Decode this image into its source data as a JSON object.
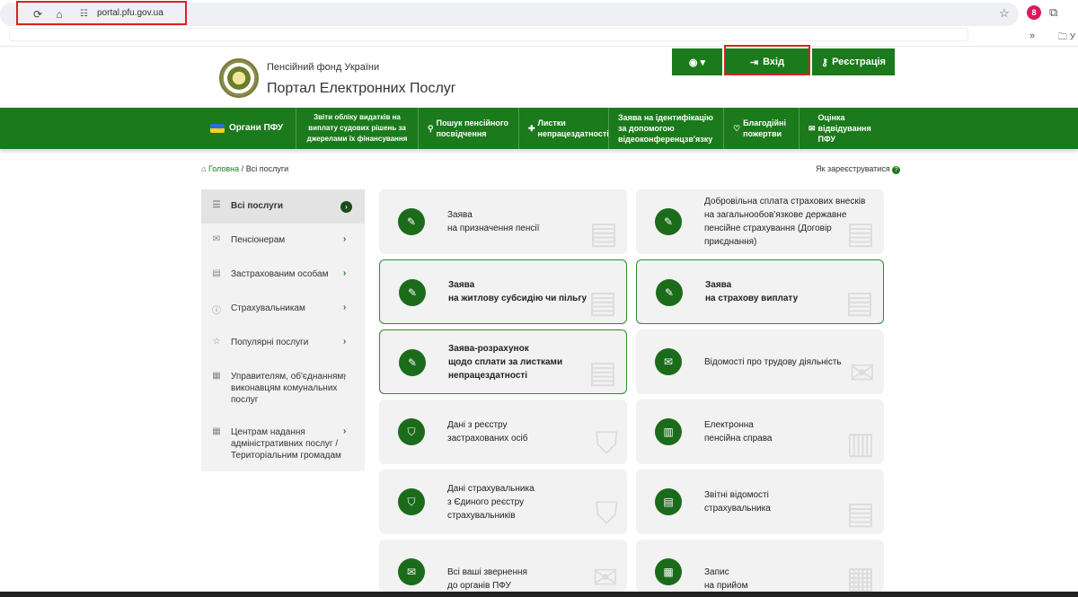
{
  "browser": {
    "url": "portal.pfu.gov.ua",
    "extension_badge": "8",
    "bookmark_more": "»",
    "bookmark_folder": "У"
  },
  "header": {
    "org_name": "Пенсійний фонд України",
    "portal_name": "Портал Електронних Послуг",
    "login_label": "Вхід",
    "register_label": "Реєстрація"
  },
  "nav": {
    "organ": "Органи ПФУ",
    "items": [
      "Звіти обліку видатків на виплату судових рішень за джерелами їх фінансування",
      "Пошук пенсійного посвідчення",
      "Листки непрацездатності",
      "Заява на ідентифікацію за допомогою відеоконференцзв'язку",
      "Благодійні пожертви",
      "Оцінка відвідування ПФУ"
    ]
  },
  "breadcrumb": {
    "home": "Головна",
    "current": "Всі послуги",
    "how_register": "Як зареєструватися"
  },
  "sidebar": {
    "items": [
      {
        "label": "Всі послуги",
        "icon": "list-icon"
      },
      {
        "label": "Пенсіонерам",
        "icon": "mail-icon"
      },
      {
        "label": "Застрахованим особам",
        "icon": "document-icon"
      },
      {
        "label": "Страхувальникам",
        "icon": "info-icon"
      },
      {
        "label": "Популярні послуги",
        "icon": "star-icon"
      },
      {
        "label": "Управителям, об'єднанням, виконавцям комунальних послуг",
        "icon": "building-icon"
      },
      {
        "label": "Центрам надання адміністративних послуг / Територіальним громадам",
        "icon": "building-icon"
      }
    ]
  },
  "cards": [
    {
      "lines": [
        "Заява",
        "на призначення пенсії"
      ],
      "outlined": false,
      "icon": "form-icon"
    },
    {
      "lines": [
        "Добровільна сплата страхових внесків на загальнообов'язкове державне пенсійне страхування (Договір приєднання)"
      ],
      "outlined": false,
      "icon": "form-icon"
    },
    {
      "lines": [
        "Заява",
        "на житлову субсидію чи пільгу"
      ],
      "outlined": true,
      "icon": "form-icon"
    },
    {
      "lines": [
        "Заява",
        "на страхову виплату"
      ],
      "outlined": true,
      "icon": "form-icon"
    },
    {
      "lines": [
        "Заява-розрахунок",
        "щодо сплати за листками непрацездатності"
      ],
      "outlined": true,
      "icon": "form-icon"
    },
    {
      "lines": [
        "Відомості про трудову діяльність"
      ],
      "outlined": false,
      "icon": "envelope-icon"
    },
    {
      "lines": [
        "Дані з реєстру",
        "застрахованих осіб"
      ],
      "outlined": false,
      "icon": "shield-icon"
    },
    {
      "lines": [
        "Електронна",
        "пенсійна справа"
      ],
      "outlined": false,
      "icon": "folder-icon"
    },
    {
      "lines": [
        "Дані страхувальника",
        "з Єдиного реєстру",
        "страхувальників"
      ],
      "outlined": false,
      "icon": "shield-icon"
    },
    {
      "lines": [
        "Звітні відомості",
        "страхувальника"
      ],
      "outlined": false,
      "icon": "report-icon"
    },
    {
      "lines": [
        "Всі ваші звернення",
        "до органів ПФУ"
      ],
      "outlined": false,
      "icon": "envelope-icon"
    },
    {
      "lines": [
        "Запис",
        "на прийом"
      ],
      "outlined": false,
      "icon": "calendar-icon"
    }
  ],
  "colors": {
    "primary_green": "#1b7a1b",
    "highlight_red": "#d62424"
  }
}
